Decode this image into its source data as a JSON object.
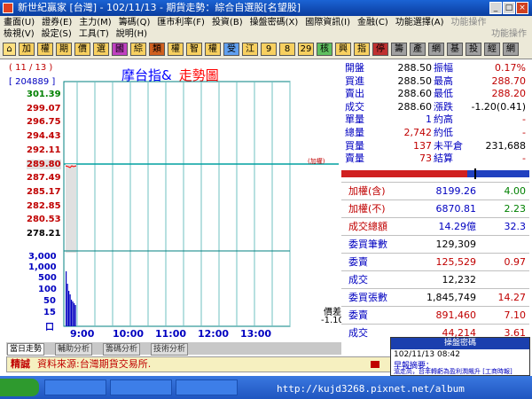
{
  "window": {
    "title": "新世紀贏家 [台灣] - 102/11/13 - 期貨走勢：綜合自選股[名望股]"
  },
  "menu": {
    "row1": [
      "畫面(U)",
      "證券(E)",
      "主力(M)",
      "籌碼(Q)",
      "匯市利率(F)",
      "投資(B)",
      "操盤密碼(X)",
      "國際資訊(I)",
      "金融(C)",
      "功能選擇(A)"
    ],
    "row1_right": "功能操作",
    "row2": [
      "檢視(V)",
      "設定(S)",
      "工具(T)",
      "說明(H)"
    ],
    "row2_right": "功能操作"
  },
  "toolbar": [
    "加",
    "權",
    "期",
    "價",
    "選",
    "國",
    "綜",
    "類",
    "權",
    "智",
    "權",
    "受",
    "江",
    "9",
    "8",
    "29",
    "核",
    "興",
    "指",
    "停",
    "籌",
    "產",
    "網",
    "基",
    "投",
    "經",
    "網"
  ],
  "chart": {
    "date": "( 11 / 13 )",
    "code": "[ 204889 ]",
    "title_part1": "摩台指&",
    "title_part2": "走勢圖",
    "price_ticks": [
      "301.39",
      "299.07",
      "296.75",
      "294.43",
      "292.11",
      "289.80",
      "287.49",
      "285.17",
      "282.85",
      "280.53",
      "278.21"
    ],
    "volume_ticks": [
      "3,000",
      "1,000",
      "500",
      "100",
      "50",
      "15",
      "口"
    ],
    "time_ticks": [
      "9:00",
      "10:00",
      "11:00",
      "12:00",
      "13:00"
    ],
    "jiaquan_marker": "(加權)",
    "diff_label": "價差",
    "diff_value": "-1.10"
  },
  "quote": [
    {
      "l": "開盤",
      "v": "288.50",
      "l2": "振幅",
      "v2": "0.17%"
    },
    {
      "l": "買進",
      "v": "288.50",
      "l2": "最高",
      "v2": "288.70"
    },
    {
      "l": "賣出",
      "v": "288.60",
      "l2": "最低",
      "v2": "288.20"
    },
    {
      "l": "成交",
      "v": "288.60",
      "l2": "漲跌",
      "v2": "-1.20(0.41)"
    },
    {
      "l": "單量",
      "v": "1",
      "l2": "約高",
      "v2": "-"
    },
    {
      "l": "總量",
      "v": "2,742",
      "l2": "約低",
      "v2": "-"
    },
    {
      "l": "買量",
      "v": "137",
      "l2": "未平倉",
      "v2": "231,688"
    },
    {
      "l": "賣量",
      "v": "73",
      "l2": "結算",
      "v2": "-"
    }
  ],
  "stats": [
    {
      "l": "加權(含)",
      "v": "8199.26",
      "v2": "4.00"
    },
    {
      "l": "加權(不)",
      "v": "6870.81",
      "v2": "2.23"
    },
    {
      "l": "成交總額",
      "v": "14.29億",
      "v2": "32.3"
    },
    {
      "l": "委買筆數",
      "v": "129,309",
      "v2": ""
    },
    {
      "l": "委賣",
      "v": "125,529",
      "v2": "0.97"
    },
    {
      "l": "成交",
      "v": "12,232",
      "v2": ""
    },
    {
      "l": "委買張數",
      "v": "1,845,749",
      "v2": "14.27"
    },
    {
      "l": "委賣",
      "v": "891,460",
      "v2": "7.10"
    },
    {
      "l": "成交",
      "v": "44,214",
      "v2": "3.61"
    }
  ],
  "tabs": [
    "當日走勢",
    "輔助分析",
    "籌碼分析",
    "技術分析"
  ],
  "status": {
    "label": "精誠",
    "text": "資料來源:台灣期貨交易所."
  },
  "popup": {
    "title": "操盤密碼",
    "time": "102/11/13 08:42",
    "line1": "早報摘要：",
    "line2": "滬走高，台苯轉虧為盈利潤飆升 [工商時報]"
  },
  "url": "http://kujd3268.pixnet.net/album",
  "colors": {
    "up": "#ff0000",
    "down": "#008000",
    "blue": "#0000ff"
  }
}
